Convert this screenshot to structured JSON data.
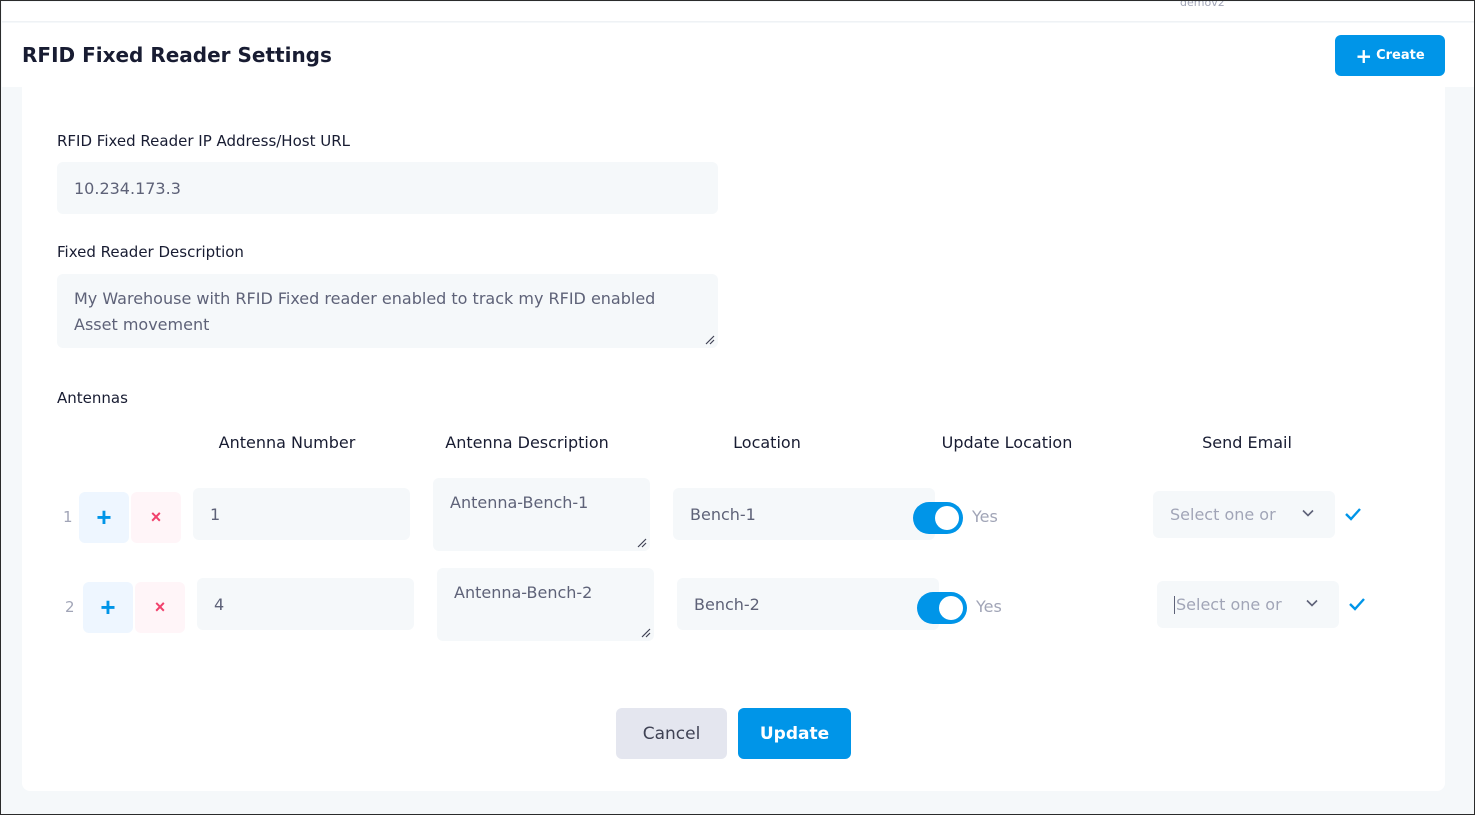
{
  "topbar": {
    "user": "demov2"
  },
  "header": {
    "title": "RFID Fixed Reader Settings",
    "create_label": "Create",
    "create_icon": "plus-icon"
  },
  "form": {
    "ip_label": "RFID Fixed Reader IP Address/Host URL",
    "ip_value": "10.234.173.3",
    "description_label": "Fixed Reader Description",
    "description_line1": "My Warehouse with RFID Fixed reader enabled to track my RFID enabled",
    "description_line2": "Asset movement"
  },
  "antennas": {
    "section_label": "Antennas",
    "columns": {
      "number": "Antenna Number",
      "description": "Antenna Description",
      "location": "Location",
      "update_location": "Update Location",
      "send_email": "Send Email"
    },
    "rows": [
      {
        "index": "1",
        "add_icon": "+",
        "remove_icon": "×",
        "number": "1",
        "description": "Antenna-Bench-1",
        "location": "Bench-1",
        "update_location": true,
        "toggle_label": "Yes",
        "send_email_placeholder": "Select one or"
      },
      {
        "index": "2",
        "add_icon": "+",
        "remove_icon": "×",
        "number": "4",
        "description": "Antenna-Bench-2",
        "location": "Bench-2",
        "update_location": true,
        "toggle_label": "Yes",
        "send_email_placeholder": "Select one or"
      }
    ]
  },
  "actions": {
    "cancel": "Cancel",
    "update": "Update"
  },
  "colors": {
    "primary": "#0095e8",
    "danger": "#f1416c",
    "field_bg": "#f5f8fa",
    "muted": "#a1a5b7"
  }
}
